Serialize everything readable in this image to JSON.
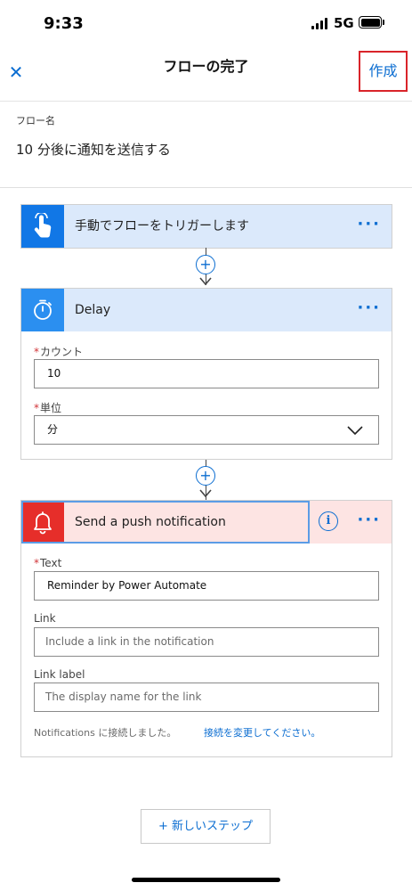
{
  "status_bar": {
    "time": "9:33",
    "network": "5G"
  },
  "header": {
    "title": "フローの完了",
    "close_icon": "close-icon",
    "create_label": "作成"
  },
  "flow_name": {
    "label": "フロー名",
    "value": "10 分後に通知を送信する"
  },
  "steps": [
    {
      "title": "手動でフローをトリガーします",
      "icon": "touch-hand-icon",
      "more": "···"
    },
    {
      "title": "Delay",
      "icon": "stopwatch-icon",
      "more": "···",
      "fields": [
        {
          "label": "カウント",
          "required": true,
          "value": "10"
        },
        {
          "label": "単位",
          "required": true,
          "value": "分"
        }
      ]
    },
    {
      "title": "Send a push notification",
      "icon": "bell-icon",
      "more": "···",
      "info": "i",
      "fields": [
        {
          "label": "Text",
          "required": true,
          "value": "Reminder by Power Automate"
        },
        {
          "label": "Link",
          "required": false,
          "placeholder": "Include a link in the notification"
        },
        {
          "label": "Link label",
          "required": false,
          "placeholder": "The display name for the link"
        }
      ],
      "connection_text": "Notifications に接続しました。",
      "connection_link": "接続を変更してください。"
    }
  ],
  "add_symbol": "+",
  "required_marker": "*",
  "new_step_label": "+ 新しいステップ",
  "colors": {
    "accent": "#0b6dd1",
    "trigger_icon_bg": "#1177e6",
    "delay_icon_bg": "#2b8ff0",
    "push_icon_bg": "#e62e2a",
    "highlight_border": "#d9242a"
  }
}
